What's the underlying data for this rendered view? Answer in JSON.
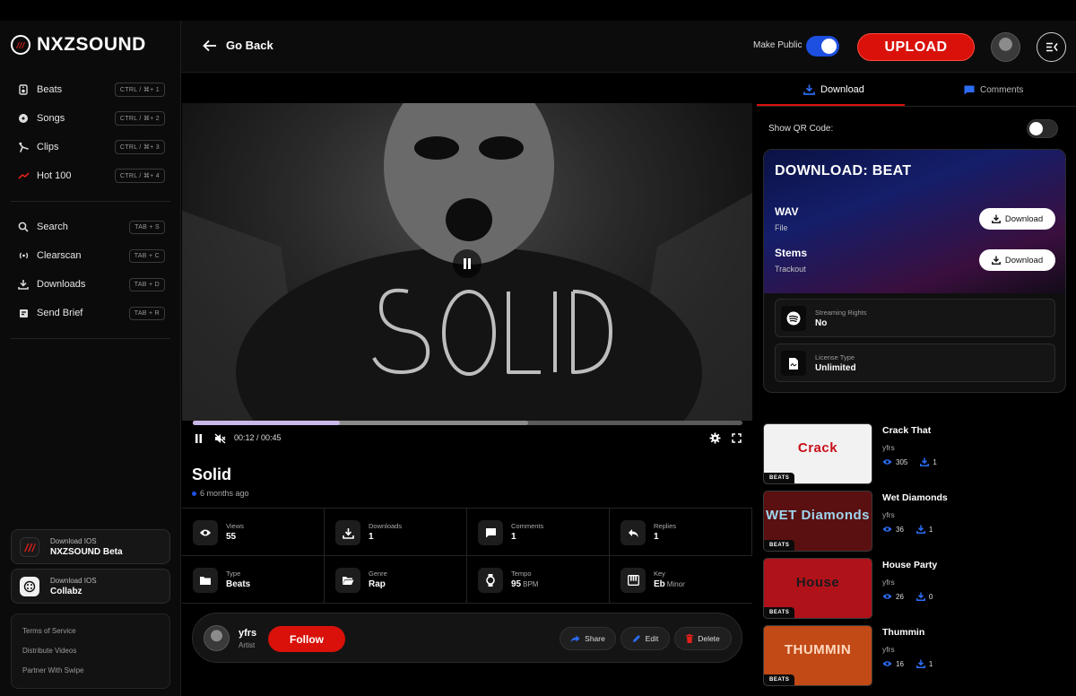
{
  "app": {
    "brand": "NXZSOUND"
  },
  "sidebar": {
    "nav": [
      {
        "label": "Beats",
        "shortcut": "CTRL / ⌘+ 1",
        "icon": "speaker-icon"
      },
      {
        "label": "Songs",
        "shortcut": "CTRL / ⌘+ 2",
        "icon": "disc-icon"
      },
      {
        "label": "Clips",
        "shortcut": "CTRL / ⌘+ 3",
        "icon": "clip-icon"
      },
      {
        "label": "Hot 100",
        "shortcut": "CTRL / ⌘+ 4",
        "icon": "trend-icon"
      }
    ],
    "tools": [
      {
        "label": "Search",
        "shortcut": "TAB + S",
        "icon": "search-icon"
      },
      {
        "label": "Clearscan",
        "shortcut": "TAB + C",
        "icon": "broadcast-icon"
      },
      {
        "label": "Downloads",
        "shortcut": "TAB + D",
        "icon": "download-icon"
      },
      {
        "label": "Send Brief",
        "shortcut": "TAB + R",
        "icon": "brief-icon"
      }
    ],
    "app_downloads": [
      {
        "small": "Download IOS",
        "big": "NXZSOUND Beta"
      },
      {
        "small": "Download IOS",
        "big": "Collabz"
      }
    ],
    "footer_links": [
      "Terms of Service",
      "Distribute Videos",
      "Partner With Swipe"
    ]
  },
  "header": {
    "back_label": "Go Back",
    "make_public_label": "Make Public",
    "make_public_on": true,
    "upload_label": "UPLOAD"
  },
  "player": {
    "time": "00:12 / 00:45",
    "progress_fraction": 0.267,
    "buffered_fraction": 0.61
  },
  "track": {
    "title": "Solid",
    "age": "6 months ago",
    "stats": [
      {
        "label": "Views",
        "value": "55",
        "unit": "",
        "icon": "eye-icon"
      },
      {
        "label": "Downloads",
        "value": "1",
        "unit": "",
        "icon": "download-icon"
      },
      {
        "label": "Comments",
        "value": "1",
        "unit": "",
        "icon": "comment-icon"
      },
      {
        "label": "Replies",
        "value": "1",
        "unit": "",
        "icon": "reply-icon"
      },
      {
        "label": "Type",
        "value": "Beats",
        "unit": "",
        "icon": "folder-icon"
      },
      {
        "label": "Genre",
        "value": "Rap",
        "unit": "",
        "icon": "folder-open-icon"
      },
      {
        "label": "Tempo",
        "value": "95",
        "unit": "BPM",
        "icon": "watch-icon"
      },
      {
        "label": "Key",
        "value": "Eb",
        "unit": "Minor",
        "icon": "piano-icon"
      }
    ]
  },
  "artist": {
    "name": "yfrs",
    "role": "Artist",
    "follow_label": "Follow",
    "share_label": "Share",
    "edit_label": "Edit",
    "delete_label": "Delete"
  },
  "right": {
    "tabs": [
      {
        "label": "Download",
        "active": true
      },
      {
        "label": "Comments",
        "active": false
      }
    ],
    "qr_label": "Show QR Code:",
    "qr_on": false,
    "download_title": "DOWNLOAD: BEAT",
    "files": [
      {
        "name": "WAV",
        "sub": "File",
        "button": "Download"
      },
      {
        "name": "Stems",
        "sub": "Trackout",
        "button": "Download"
      }
    ],
    "info": [
      {
        "label": "Streaming Rights",
        "value": "No",
        "icon": "spotify-icon"
      },
      {
        "label": "License Type",
        "value": "Unlimited",
        "icon": "document-icon"
      }
    ]
  },
  "related": [
    {
      "title": "Crack That",
      "artist": "yfrs",
      "views": "305",
      "downloads": "1",
      "tag": "BEATS",
      "thumb_text": "Crack",
      "thumb_bg": "#f2f2f2",
      "thumb_color": "#c8101a"
    },
    {
      "title": "Wet Diamonds",
      "artist": "yfrs",
      "views": "36",
      "downloads": "1",
      "tag": "BEATS",
      "thumb_text": "WET Diamonds",
      "thumb_bg": "#5a1010",
      "thumb_color": "#9fd6f0"
    },
    {
      "title": "House Party",
      "artist": "yfrs",
      "views": "26",
      "downloads": "0",
      "tag": "BEATS",
      "thumb_text": "House",
      "thumb_bg": "#b0121a",
      "thumb_color": "#1a1a1a"
    },
    {
      "title": "Thummin",
      "artist": "yfrs",
      "views": "16",
      "downloads": "1",
      "tag": "BEATS",
      "thumb_text": "THUMMIN",
      "thumb_bg": "#c24a16",
      "thumb_color": "#ffd9c0"
    }
  ]
}
